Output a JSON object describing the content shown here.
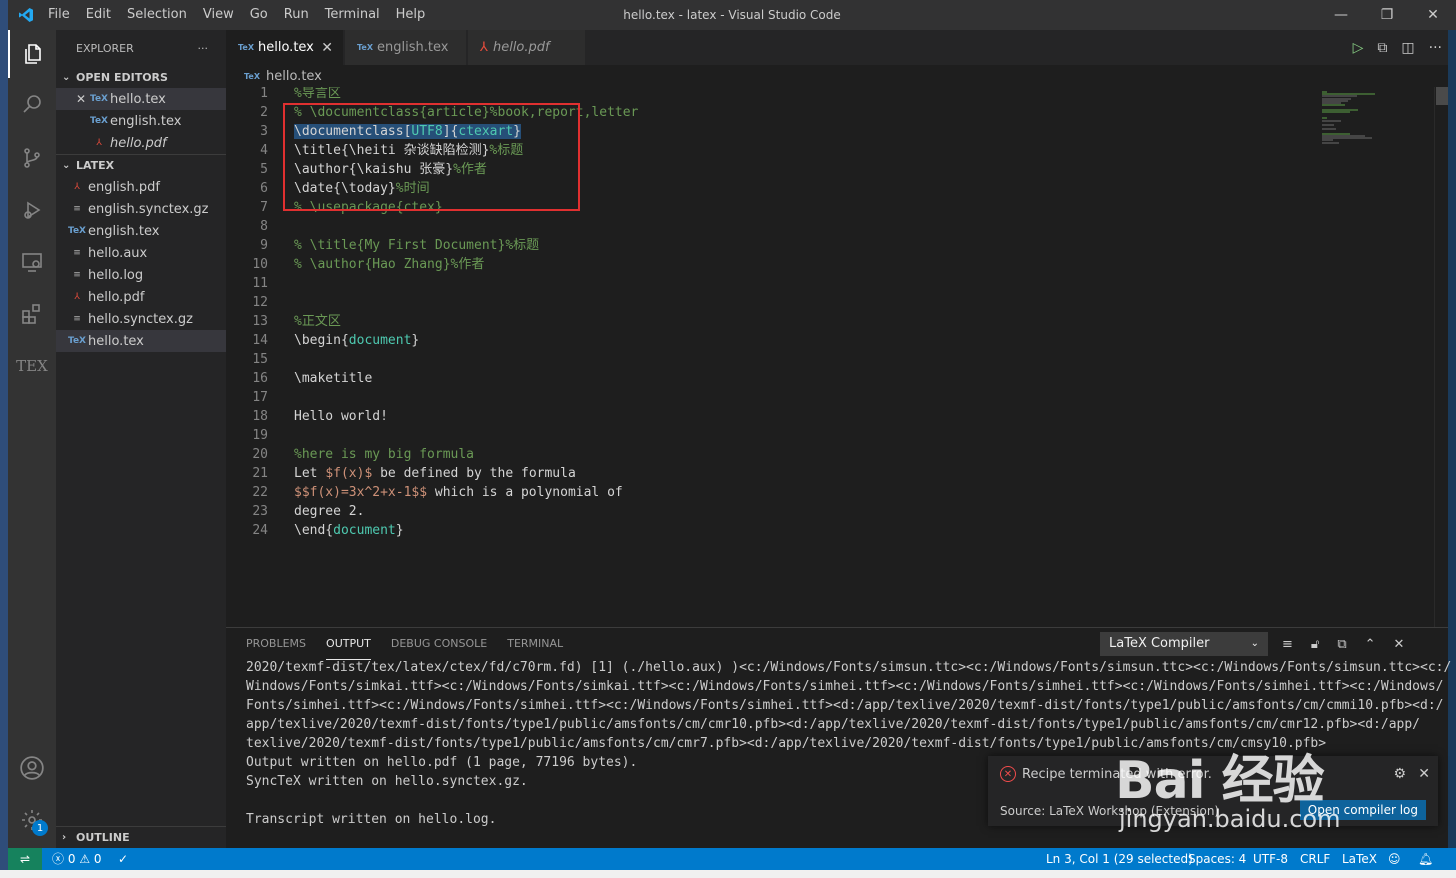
{
  "window": {
    "title": "hello.tex - latex - Visual Studio Code",
    "menu": [
      "File",
      "Edit",
      "Selection",
      "View",
      "Go",
      "Run",
      "Terminal",
      "Help"
    ]
  },
  "sidebar": {
    "title": "EXPLORER",
    "more": "···",
    "open_editors_label": "OPEN EDITORS",
    "open_editors": [
      {
        "name": "hello.tex",
        "type": "tex"
      },
      {
        "name": "english.tex",
        "type": "tex"
      },
      {
        "name": "hello.pdf",
        "type": "pdf"
      }
    ],
    "folder_label": "LATEX",
    "files": [
      {
        "name": "english.pdf",
        "type": "pdf"
      },
      {
        "name": "english.synctex.gz",
        "type": "file"
      },
      {
        "name": "english.tex",
        "type": "tex"
      },
      {
        "name": "hello.aux",
        "type": "file"
      },
      {
        "name": "hello.log",
        "type": "file"
      },
      {
        "name": "hello.pdf",
        "type": "pdf"
      },
      {
        "name": "hello.synctex.gz",
        "type": "file"
      },
      {
        "name": "hello.tex",
        "type": "tex"
      }
    ],
    "outline_label": "OUTLINE"
  },
  "tabs": [
    {
      "label": "hello.tex",
      "type": "tex"
    },
    {
      "label": "english.tex",
      "type": "tex"
    },
    {
      "label": "hello.pdf",
      "type": "pdf"
    }
  ],
  "breadcrumb": "hello.tex",
  "code_lines": [
    {
      "n": "1",
      "t": "%导言区"
    },
    {
      "n": "2",
      "t": "% \\documentclass{article}%book,report,letter"
    },
    {
      "n": "3",
      "t": "\\documentclass[UTF8]{ctexart}"
    },
    {
      "n": "4",
      "t": "\\title{\\heiti 杂谈缺陷检测}%标题"
    },
    {
      "n": "5",
      "t": "\\author{\\kaishu 张豪}%作者"
    },
    {
      "n": "6",
      "t": "\\date{\\today}%时间"
    },
    {
      "n": "7",
      "t": "% \\usepackage{ctex}"
    },
    {
      "n": "8",
      "t": ""
    },
    {
      "n": "9",
      "t": "% \\title{My First Document}%标题"
    },
    {
      "n": "10",
      "t": "% \\author{Hao Zhang}%作者"
    },
    {
      "n": "11",
      "t": ""
    },
    {
      "n": "12",
      "t": ""
    },
    {
      "n": "13",
      "t": "%正文区"
    },
    {
      "n": "14",
      "t": "\\begin{document}"
    },
    {
      "n": "15",
      "t": ""
    },
    {
      "n": "16",
      "t": "\\maketitle"
    },
    {
      "n": "17",
      "t": ""
    },
    {
      "n": "18",
      "t": "Hello world!"
    },
    {
      "n": "19",
      "t": ""
    },
    {
      "n": "20",
      "t": "%here is my big formula"
    },
    {
      "n": "21",
      "t": "Let $f(x)$ be defined by the formula"
    },
    {
      "n": "22",
      "t": "$$f(x)=3x^2+x-1$$ which is a polynomial of"
    },
    {
      "n": "23",
      "t": "degree 2."
    },
    {
      "n": "24",
      "t": "\\end{document}"
    }
  ],
  "panel": {
    "tabs": [
      "PROBLEMS",
      "OUTPUT",
      "DEBUG CONSOLE",
      "TERMINAL"
    ],
    "active_tab": "OUTPUT",
    "channel": "LaTeX Compiler",
    "output_lines": [
      "2020/texmf-dist/tex/latex/ctex/fd/c70rm.fd) [1] (./hello.aux) )<c:/Windows/Fonts/simsun.ttc><c:/Windows/Fonts/simsun.ttc><c:/Windows/Fonts/simsun.ttc><c:/",
      "Windows/Fonts/simkai.ttf><c:/Windows/Fonts/simkai.ttf><c:/Windows/Fonts/simhei.ttf><c:/Windows/Fonts/simhei.ttf><c:/Windows/Fonts/simhei.ttf><c:/Windows/",
      "Fonts/simhei.ttf><c:/Windows/Fonts/simhei.ttf><c:/Windows/Fonts/simhei.ttf><d:/app/texlive/2020/texmf-dist/fonts/type1/public/amsfonts/cm/cmmi10.pfb><d:/",
      "app/texlive/2020/texmf-dist/fonts/type1/public/amsfonts/cm/cmr10.pfb><d:/app/texlive/2020/texmf-dist/fonts/type1/public/amsfonts/cm/cmr12.pfb><d:/app/",
      "texlive/2020/texmf-dist/fonts/type1/public/amsfonts/cm/cmr7.pfb><d:/app/texlive/2020/texmf-dist/fonts/type1/public/amsfonts/cm/cmsy10.pfb>",
      "Output written on hello.pdf (1 page, 77196 bytes).",
      "SyncTeX written on hello.synctex.gz.",
      "",
      "Transcript written on hello.log."
    ]
  },
  "notification": {
    "message": "Recipe terminated with error.",
    "source": "Source: LaTeX Workshop (Extension)",
    "button": "Open compiler log"
  },
  "watermark": {
    "logo": "Bai 经验",
    "url": "jingyan.baidu.com"
  },
  "status": {
    "errors": "0",
    "warnings": "0",
    "position": "Ln 3, Col 1 (29 selected)",
    "spaces": "Spaces: 4",
    "encoding": "UTF-8",
    "eol": "CRLF",
    "language": "LaTeX"
  },
  "colors": {
    "accent": "#007acc",
    "highlight_box": "#e03030",
    "remote": "#16825d"
  }
}
